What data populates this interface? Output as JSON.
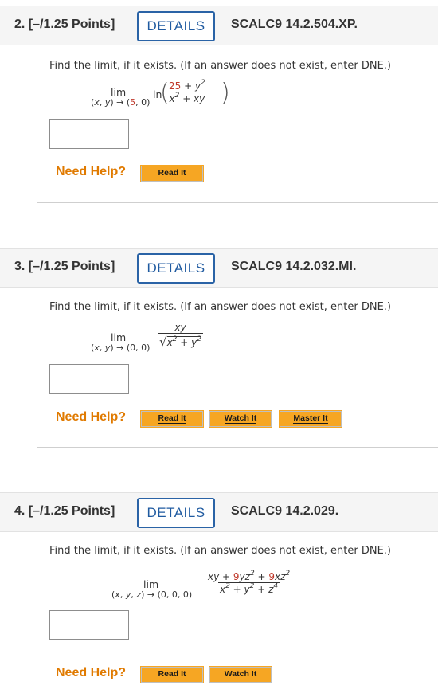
{
  "questions": [
    {
      "number": "2. [–/1.25 Points]",
      "details_label": "DETAILS",
      "code": "SCALC9 14.2.504.XP.",
      "prompt": "Find the limit, if it exists. (If an answer does not exist, enter DNE.)",
      "limit": {
        "lim_label": "lim",
        "approach": "(x, y) → (5, 0)",
        "function": "ln",
        "numerator": "25 + y²",
        "denominator": "x² + xy"
      },
      "answer_value": "",
      "need_help": "Need Help?",
      "help_buttons": [
        "Read It"
      ]
    },
    {
      "number": "3. [–/1.25 Points]",
      "details_label": "DETAILS",
      "code": "SCALC9 14.2.032.MI.",
      "prompt": "Find the limit, if it exists. (If an answer does not exist, enter DNE.)",
      "limit": {
        "lim_label": "lim",
        "approach": "(x, y) → (0, 0)",
        "numerator": "xy",
        "denominator": "√(x² + y²)"
      },
      "answer_value": "",
      "need_help": "Need Help?",
      "help_buttons": [
        "Read It",
        "Watch It",
        "Master It"
      ]
    },
    {
      "number": "4. [–/1.25 Points]",
      "details_label": "DETAILS",
      "code": "SCALC9 14.2.029.",
      "prompt": "Find the limit, if it exists. (If an answer does not exist, enter DNE.)",
      "limit": {
        "lim_label": "lim",
        "approach": "(x, y, z) → (0, 0, 0)",
        "numerator": "xy + 9yz² + 9xz²",
        "denominator": "x² + y² + z⁴"
      },
      "answer_value": "",
      "need_help": "Need Help?",
      "help_buttons": [
        "Read It",
        "Watch It"
      ]
    }
  ],
  "colors": {
    "details_border": "#2a63a6",
    "need_help": "#e07a00",
    "help_button": "#f6a623",
    "highlight_number": "#c0392b"
  }
}
